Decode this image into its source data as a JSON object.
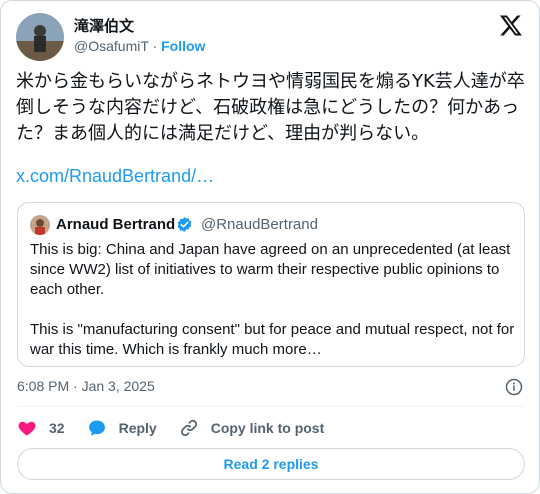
{
  "author": {
    "display_name": "滝澤伯文",
    "handle": "@OsafumiT",
    "separator": "·",
    "follow_label": "Follow"
  },
  "tweet": {
    "text": "米から金もらいながらネトウヨや情弱国民を煽るYK芸人達が卒倒しそうな内容だけど、石破政権は急にどうしたの？何かあった？まあ個人的には満足だけど、理由が判らない。",
    "link": "x.com/RnaudBertrand/…"
  },
  "quote": {
    "name": "Arnaud Bertrand",
    "handle": "@RnaudBertrand",
    "text": "This is big: China and Japan have agreed on an unprecedented (at least since WW2) list of initiatives to warm their respective public opinions to each other.\n\nThis is \"manufacturing consent\" but for peace and mutual respect, not for war this time. Which is frankly much more…"
  },
  "meta": {
    "timestamp": "6:08 PM · Jan 3, 2025"
  },
  "actions": {
    "like_count": "32",
    "reply_label": "Reply",
    "copy_label": "Copy link to post",
    "read_replies_label": "Read 2 replies"
  },
  "colors": {
    "accent": "#1d9bf0",
    "like": "#f91880",
    "text": "#0f1419",
    "muted": "#536471",
    "border": "#cfd9de"
  },
  "icons": [
    "x-logo-icon",
    "verified-badge-icon",
    "info-icon",
    "heart-icon",
    "reply-bubble-icon",
    "link-icon"
  ]
}
